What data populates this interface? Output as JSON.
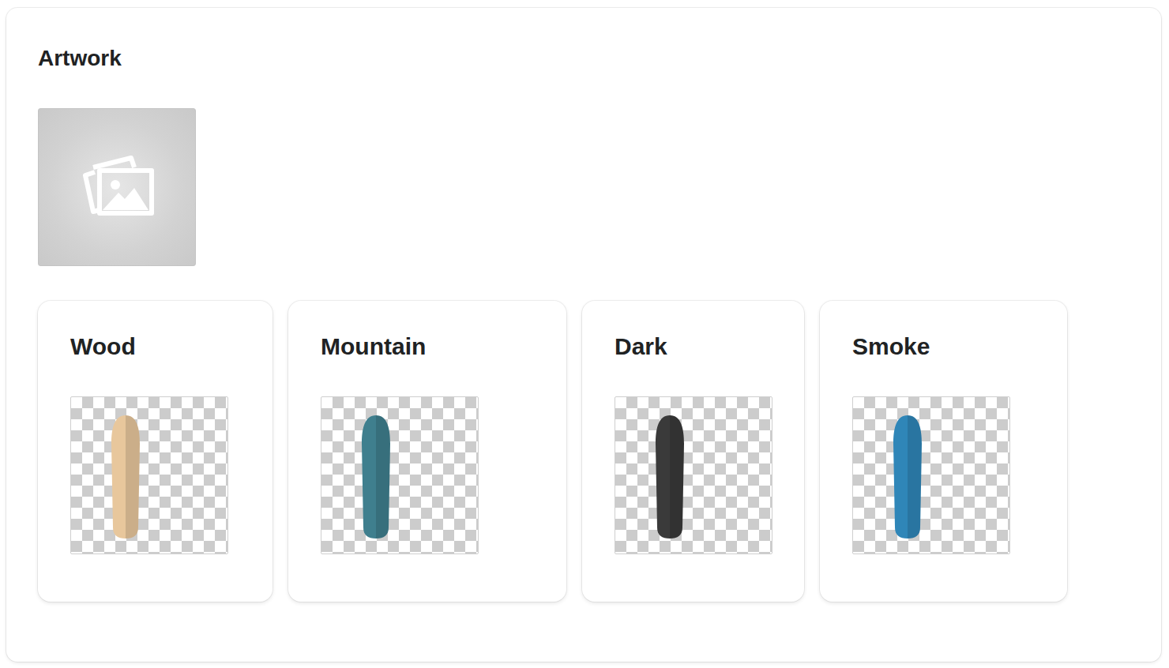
{
  "section": {
    "title": "Artwork"
  },
  "variants": [
    {
      "name": "Wood",
      "color": "#e8c79c"
    },
    {
      "name": "Mountain",
      "color": "#3f7f8e"
    },
    {
      "name": "Dark",
      "color": "#3a3a3a"
    },
    {
      "name": "Smoke",
      "color": "#2f86b8"
    }
  ]
}
